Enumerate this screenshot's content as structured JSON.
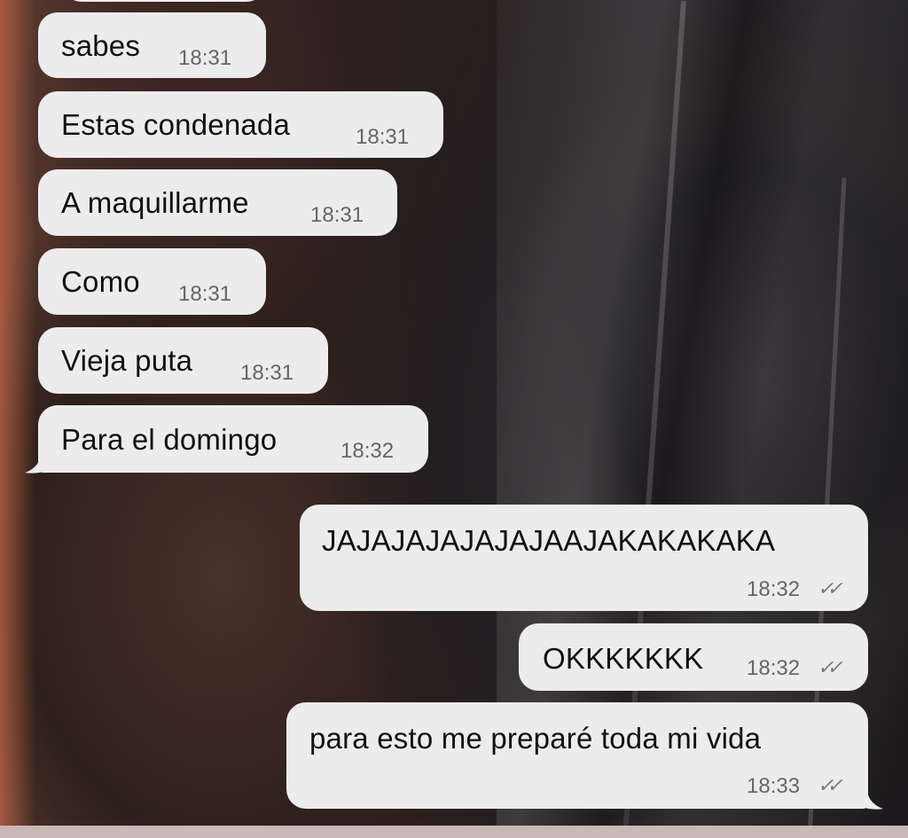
{
  "messages": [
    {
      "dir": "in",
      "text": "sabes",
      "time": "18:31"
    },
    {
      "dir": "in",
      "text": "Estas condenada",
      "time": "18:31"
    },
    {
      "dir": "in",
      "text": "A maquillarme",
      "time": "18:31"
    },
    {
      "dir": "in",
      "text": "Como",
      "time": "18:31"
    },
    {
      "dir": "in",
      "text": "Vieja puta",
      "time": "18:31"
    },
    {
      "dir": "in",
      "text": "Para el domingo",
      "time": "18:32"
    },
    {
      "dir": "out",
      "text": "JAJAJAJAJAJAJAAJAKAKAKAKA",
      "time": "18:32",
      "status": "✓✓"
    },
    {
      "dir": "out",
      "text": "OKKKKKKK",
      "time": "18:32",
      "status": "✓✓"
    },
    {
      "dir": "out",
      "text": "para esto me preparé toda mi vida",
      "time": "18:33",
      "status": "✓✓"
    }
  ],
  "colors": {
    "bubble": "#ececec",
    "time": "#666666",
    "text": "#111111"
  },
  "icons": {
    "read_receipt": "double-check-icon"
  }
}
